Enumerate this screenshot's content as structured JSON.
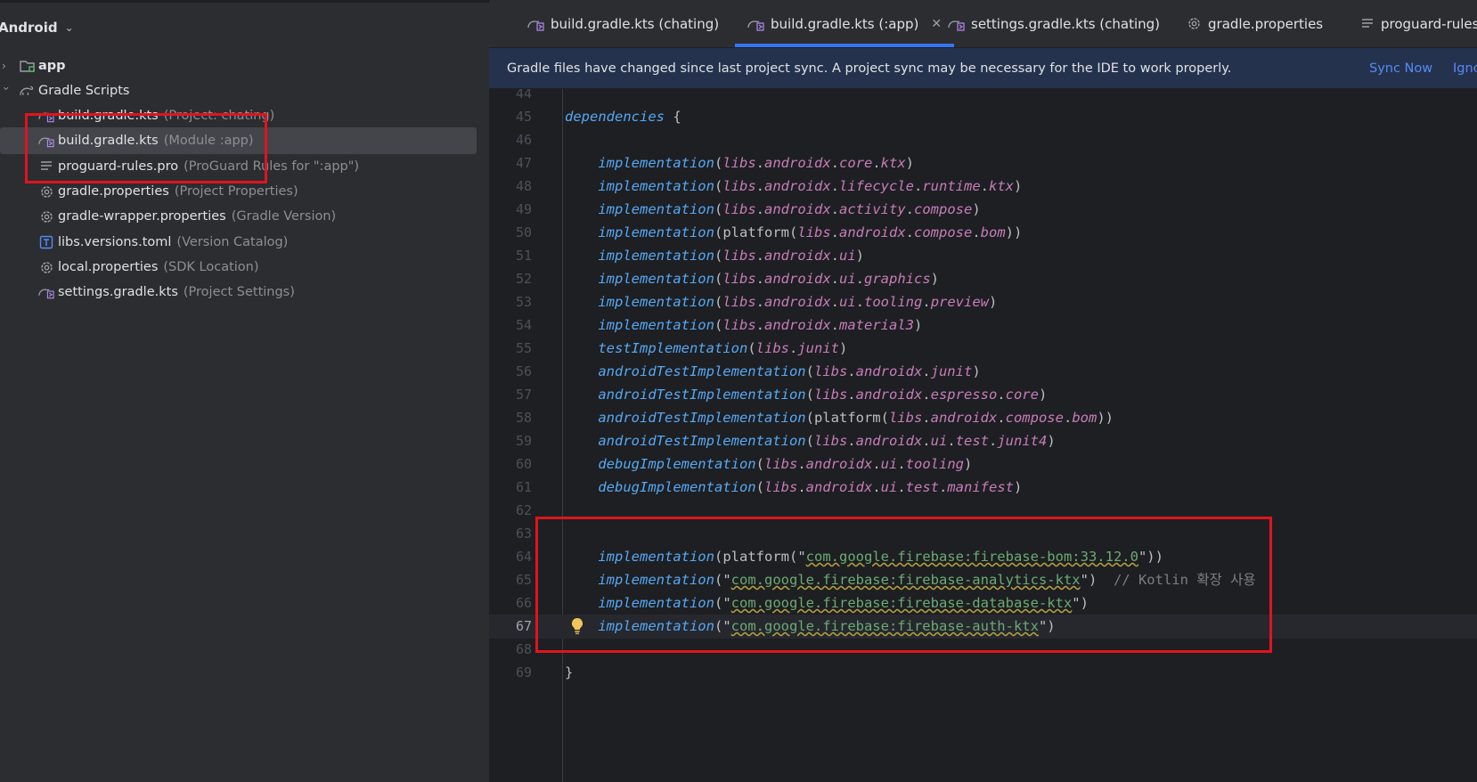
{
  "project_panel": {
    "title": "Android",
    "items": [
      {
        "name": "app",
        "hint": "",
        "icon": "module-folder-icon"
      },
      {
        "name": "Gradle Scripts",
        "hint": "",
        "icon": "gradle-icon"
      },
      {
        "name": "build.gradle.kts",
        "hint": "(Project: chating)",
        "icon": "gradle-kts-icon"
      },
      {
        "name": "build.gradle.kts",
        "hint": "(Module :app)",
        "icon": "gradle-kts-icon"
      },
      {
        "name": "proguard-rules.pro",
        "hint": "(ProGuard Rules for \":app\")",
        "icon": "lines-icon"
      },
      {
        "name": "gradle.properties",
        "hint": "(Project Properties)",
        "icon": "gear-icon"
      },
      {
        "name": "gradle-wrapper.properties",
        "hint": "(Gradle Version)",
        "icon": "gear-icon"
      },
      {
        "name": "libs.versions.toml",
        "hint": "(Version Catalog)",
        "icon": "toml-icon"
      },
      {
        "name": "local.properties",
        "hint": "(SDK Location)",
        "icon": "gear-icon"
      },
      {
        "name": "settings.gradle.kts",
        "hint": "(Project Settings)",
        "icon": "gradle-kts-icon"
      }
    ]
  },
  "tabs": [
    {
      "label": "build.gradle.kts (chating)",
      "icon": "gradle-kts-icon"
    },
    {
      "label": "build.gradle.kts (:app)",
      "icon": "gradle-kts-icon",
      "active": true
    },
    {
      "label": "settings.gradle.kts (chating)",
      "icon": "gradle-kts-icon"
    },
    {
      "label": "gradle.properties",
      "icon": "gear-icon"
    },
    {
      "label": "proguard-rules.p",
      "icon": "lines-icon"
    }
  ],
  "banner": {
    "message": "Gradle files have changed since last project sync. A project sync may be necessary for the IDE to work properly.",
    "sync_now": "Sync Now",
    "ignore": "Ignc"
  },
  "editor": {
    "current_line": 67,
    "lines": [
      {
        "n": "44",
        "code": ""
      },
      {
        "n": "45",
        "code": "dependencies {"
      },
      {
        "n": "46",
        "code": ""
      },
      {
        "n": "47",
        "code": "    implementation(libs.androidx.core.ktx)"
      },
      {
        "n": "48",
        "code": "    implementation(libs.androidx.lifecycle.runtime.ktx)"
      },
      {
        "n": "49",
        "code": "    implementation(libs.androidx.activity.compose)"
      },
      {
        "n": "50",
        "code": "    implementation(platform(libs.androidx.compose.bom))"
      },
      {
        "n": "51",
        "code": "    implementation(libs.androidx.ui)"
      },
      {
        "n": "52",
        "code": "    implementation(libs.androidx.ui.graphics)"
      },
      {
        "n": "53",
        "code": "    implementation(libs.androidx.ui.tooling.preview)"
      },
      {
        "n": "54",
        "code": "    implementation(libs.androidx.material3)"
      },
      {
        "n": "55",
        "code": "    testImplementation(libs.junit)"
      },
      {
        "n": "56",
        "code": "    androidTestImplementation(libs.androidx.junit)"
      },
      {
        "n": "57",
        "code": "    androidTestImplementation(libs.androidx.espresso.core)"
      },
      {
        "n": "58",
        "code": "    androidTestImplementation(platform(libs.androidx.compose.bom))"
      },
      {
        "n": "59",
        "code": "    androidTestImplementation(libs.androidx.ui.test.junit4)"
      },
      {
        "n": "60",
        "code": "    debugImplementation(libs.androidx.ui.tooling)"
      },
      {
        "n": "61",
        "code": "    debugImplementation(libs.androidx.ui.test.manifest)"
      },
      {
        "n": "62",
        "code": ""
      },
      {
        "n": "63",
        "code": ""
      },
      {
        "n": "64",
        "code": "    implementation(platform(\"com.google.firebase:firebase-bom:33.12.0\"))"
      },
      {
        "n": "65",
        "code": "    implementation(\"com.google.firebase:firebase-analytics-ktx\")  // Kotlin 확장 사용"
      },
      {
        "n": "66",
        "code": "    implementation(\"com.google.firebase:firebase-database-ktx\")"
      },
      {
        "n": "67",
        "code": "    implementation(\"com.google.firebase:firebase-auth-ktx\")"
      },
      {
        "n": "68",
        "code": ""
      },
      {
        "n": "69",
        "code": "}"
      }
    ]
  },
  "colors": {
    "accent": "#3574f0",
    "highlight_box": "#e0141e",
    "keyword": "#56a8f5",
    "property": "#c77dbb",
    "string": "#6aab73"
  }
}
